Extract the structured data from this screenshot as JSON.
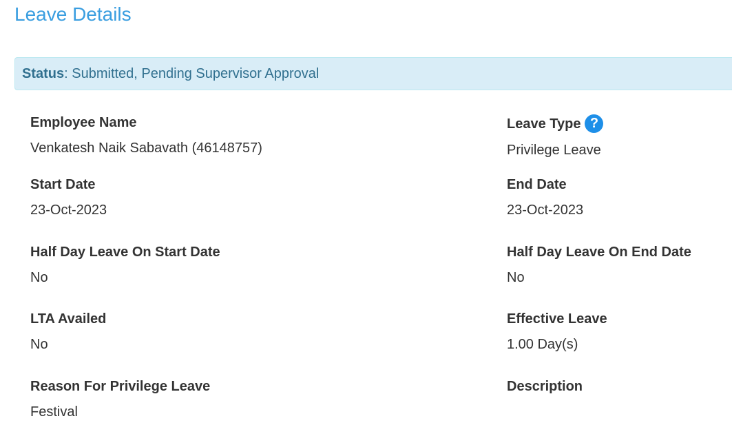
{
  "page": {
    "title": "Leave Details"
  },
  "status": {
    "label": "Status",
    "separator": ":",
    "text": "Submitted, Pending Supervisor Approval"
  },
  "fields": {
    "employee_name": {
      "label": "Employee Name",
      "value": "Venkatesh Naik Sabavath (46148757)"
    },
    "leave_type": {
      "label": "Leave Type",
      "value": "Privilege Leave",
      "help_icon": "question-circle-icon"
    },
    "start_date": {
      "label": "Start Date",
      "value": "23-Oct-2023"
    },
    "end_date": {
      "label": "End Date",
      "value": "23-Oct-2023"
    },
    "half_day_start": {
      "label": "Half Day Leave On Start Date",
      "value": "No"
    },
    "half_day_end": {
      "label": "Half Day Leave On End Date",
      "value": "No"
    },
    "lta_availed": {
      "label": "LTA Availed",
      "value": "No"
    },
    "effective_leave": {
      "label": "Effective Leave",
      "value": "1.00 Day(s)"
    },
    "reason": {
      "label": "Reason For Privilege Leave",
      "value": "Festival"
    },
    "description": {
      "label": "Description",
      "value": ""
    }
  },
  "colors": {
    "title": "#3a9ee0",
    "alert_bg": "#d9edf7",
    "alert_border": "#bce8f1",
    "alert_text": "#31708f",
    "help_icon": "#1e8fe8",
    "text": "#333333"
  }
}
